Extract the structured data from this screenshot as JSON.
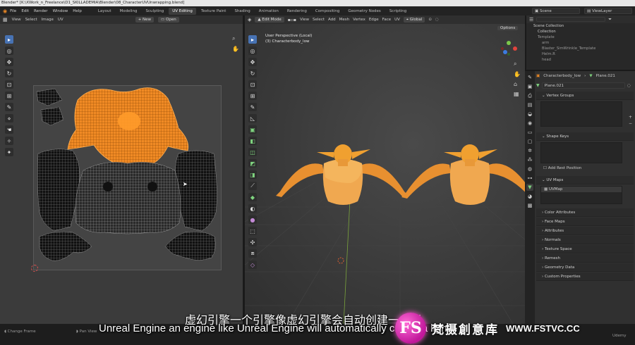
{
  "window": {
    "title": "Blender* [K:\\XWork_n_Freelance\\D1_SKILLADEMIA\\Blender\\08_CharacterUVUnwrapping.blend]"
  },
  "topbar": {
    "menu": [
      "File",
      "Edit",
      "Render",
      "Window",
      "Help"
    ],
    "workspaces": [
      "Layout",
      "Modeling",
      "Sculpting",
      "UV Editing",
      "Texture Paint",
      "Shading",
      "Animation",
      "Rendering",
      "Compositing",
      "Geometry Nodes",
      "Scripting"
    ],
    "active_workspace": "UV Editing",
    "scene": "Scene",
    "view_layer": "ViewLayer"
  },
  "uv_editor": {
    "menu": [
      "View",
      "Select",
      "Image",
      "UV"
    ],
    "new_label": "New",
    "open_label": "Open"
  },
  "viewport": {
    "mode": "Edit Mode",
    "menu": [
      "View",
      "Select",
      "Add",
      "Mesh",
      "Vertex",
      "Edge",
      "Face",
      "UV"
    ],
    "orientation": "Global",
    "options_label": "Options",
    "info_line1": "User Perspective (Local)",
    "info_line2": "(3) Characterbody_low",
    "gizmo_axes": [
      "X",
      "Y",
      "Z"
    ]
  },
  "outliner": {
    "rows": [
      {
        "label": "Scene Collection",
        "selected": false
      },
      {
        "label": "Collection",
        "selected": false
      },
      {
        "label": "Template",
        "selected": false
      },
      {
        "label": "arm",
        "selected": false
      },
      {
        "label": "Blaster_SimWrinkle_Template",
        "selected": false
      },
      {
        "label": "Helm.R",
        "selected": false
      },
      {
        "label": "head",
        "selected": false
      }
    ]
  },
  "properties": {
    "object_name": "Characterbody_low",
    "mesh_name": "Plane.021",
    "data_name": "Plane.021",
    "panels": {
      "vertex_groups": "Vertex Groups",
      "shape_keys": "Shape Keys",
      "add_rest_position": "Add Rest Position",
      "uv_maps": "UV Maps",
      "uv_map_item": "UVMap"
    },
    "collapsed": [
      "Color Attributes",
      "Face Maps",
      "Attributes",
      "Normals",
      "Texture Space",
      "Remesh",
      "Geometry Data",
      "Custom Properties"
    ]
  },
  "statusbar": {
    "left": "Change Frame",
    "middle": "Pan View",
    "right": "Udemy"
  },
  "subtitles": {
    "zh": "虚幻引擎一个引擎像虚幻引擎会自动创建一个光",
    "en": "Unreal Engine an engine like Unreal Engine will automatically create a light"
  },
  "watermark": {
    "logo": "FS",
    "name": "梵摄創意库",
    "url": "WWW.FSTVC.CC"
  },
  "colors": {
    "accent": "#4772b3",
    "uv_selected": "#f08a24",
    "model_orange": "#f0a030"
  }
}
